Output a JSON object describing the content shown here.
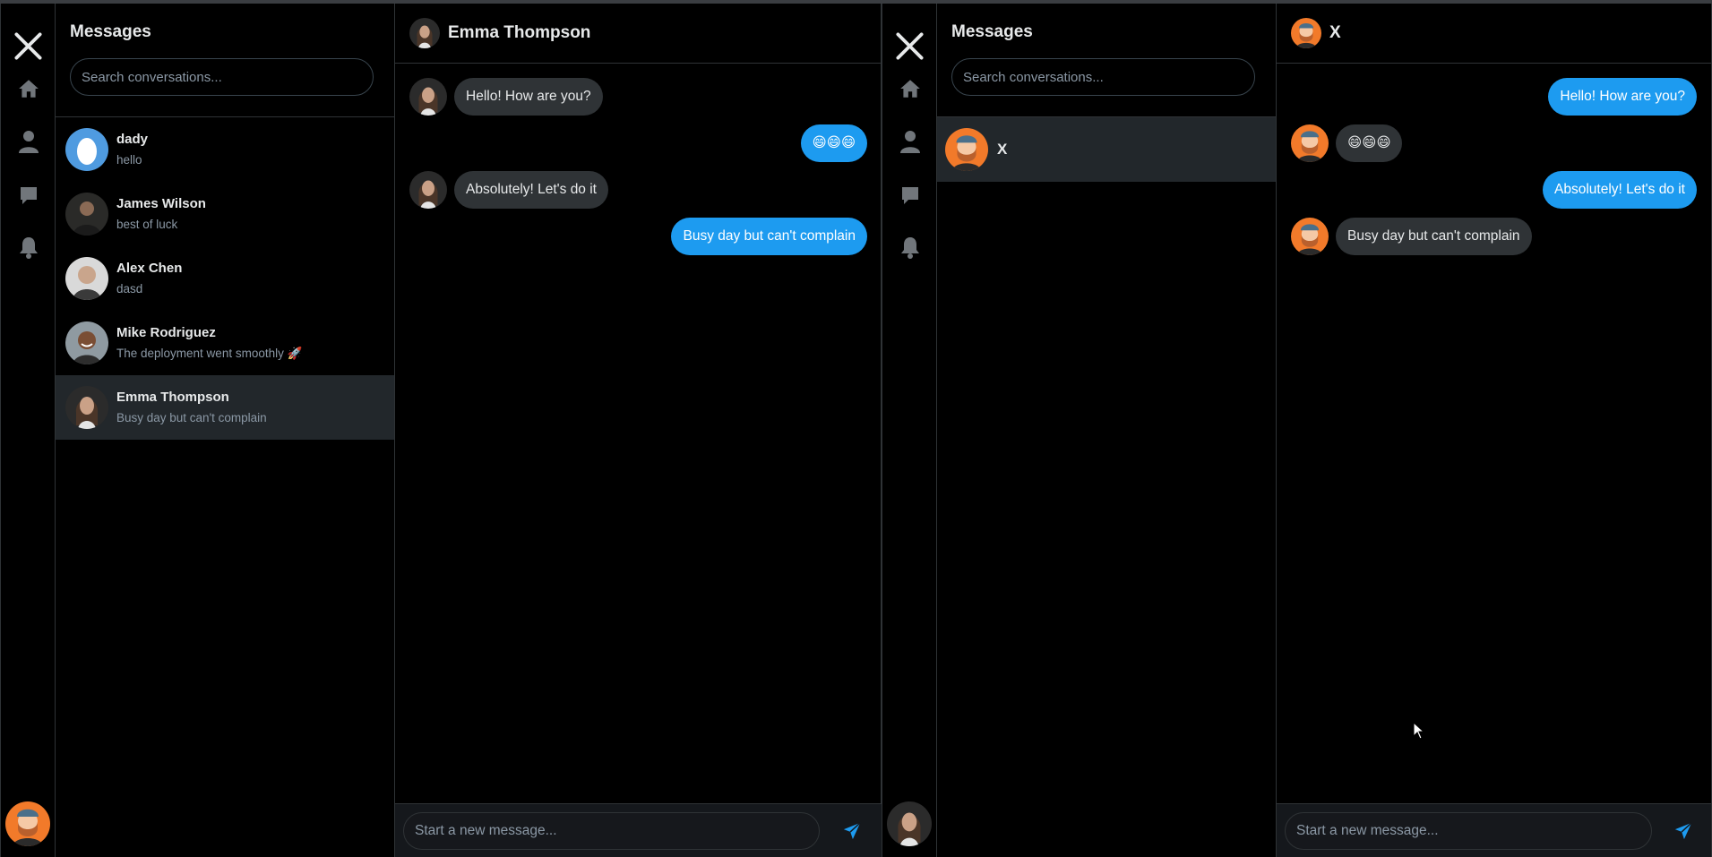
{
  "colors": {
    "background": "#000000",
    "border": "#2f3336",
    "accent": "#1d9bf0",
    "incoming_bubble": "#2f3336",
    "active_row": "#22272b",
    "muted_text": "#8b98a5"
  },
  "icons": {
    "logo": "x-logo-icon",
    "nav": [
      "home-icon",
      "profile-icon",
      "messages-icon",
      "notifications-icon"
    ],
    "send": "send-icon"
  },
  "left_app": {
    "list": {
      "title": "Messages",
      "search_placeholder": "Search conversations...",
      "conversations": [
        {
          "name": "dady",
          "preview": "hello",
          "avatar": "default-egg-avatar"
        },
        {
          "name": "James Wilson",
          "preview": "best of luck",
          "avatar": "photo-man-suit"
        },
        {
          "name": "Alex Chen",
          "preview": "dasd",
          "avatar": "photo-bald-man"
        },
        {
          "name": "Mike Rodriguez",
          "preview": "The deployment went smoothly 🚀",
          "avatar": "photo-smiling-man"
        },
        {
          "name": "Emma Thompson",
          "preview": "Busy day but can't complain",
          "avatar": "photo-woman-long-hair",
          "active": true
        }
      ]
    },
    "chat": {
      "title": "Emma Thompson",
      "messages": [
        {
          "direction": "in",
          "text": "Hello! How are you?"
        },
        {
          "direction": "out",
          "text": "😄😄😄"
        },
        {
          "direction": "in",
          "text": "Absolutely! Let's do it"
        },
        {
          "direction": "out",
          "text": "Busy day but can't complain"
        }
      ],
      "composer_placeholder": "Start a new message..."
    },
    "current_user_avatar": "illustrated-bearded-man-orange"
  },
  "right_app": {
    "list": {
      "title": "Messages",
      "search_placeholder": "Search conversations...",
      "conversations": [
        {
          "name": "X",
          "avatar": "illustrated-bearded-man-orange",
          "active": true
        }
      ]
    },
    "chat": {
      "title": "X",
      "messages": [
        {
          "direction": "out",
          "text": "Hello! How are you?"
        },
        {
          "direction": "in",
          "text": "😄😄😄"
        },
        {
          "direction": "out",
          "text": "Absolutely! Let's do it"
        },
        {
          "direction": "in",
          "text": "Busy day but can't complain"
        }
      ],
      "composer_placeholder": "Start a new message..."
    },
    "current_user_avatar": "photo-woman-long-hair"
  }
}
